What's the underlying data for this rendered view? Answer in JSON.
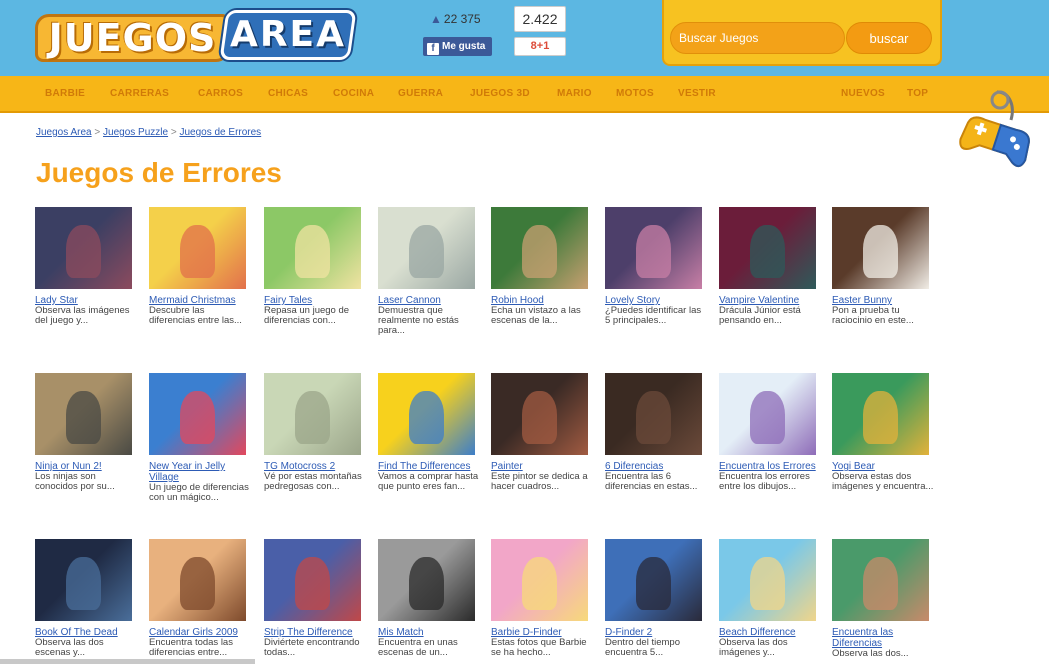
{
  "header": {
    "logo_word1": "JUEGOS",
    "logo_word2": "AREA",
    "like_count": "22 375",
    "fb_label": "Me gusta",
    "plus_count": "2.422",
    "plus_label": "8+1",
    "search_placeholder": "Buscar Juegos",
    "search_button": "buscar"
  },
  "nav": [
    "BARBIE",
    "CARRERAS",
    "CARROS",
    "CHICAS",
    "COCINA",
    "GUERRA",
    "JUEGOS 3D",
    "MARIO",
    "MOTOS",
    "VESTIR",
    "NUEVOS",
    "TOP"
  ],
  "breadcrumb": [
    "Juegos Area",
    "Juegos Puzzle",
    "Juegos de Errores"
  ],
  "breadcrumb_sep": ">",
  "page_title": "Juegos de Errores",
  "games": [
    {
      "title": "Lady Star",
      "desc": "Observa las imágenes del juego y..."
    },
    {
      "title": "Mermaid Christmas",
      "desc": "Descubre las diferencias entre las..."
    },
    {
      "title": "Fairy Tales",
      "desc": "Repasa un juego de diferencias con..."
    },
    {
      "title": "Laser Cannon",
      "desc": "Demuestra que realmente no estás para..."
    },
    {
      "title": "Robin Hood",
      "desc": "Echa un vistazo a las escenas de la..."
    },
    {
      "title": "Lovely Story",
      "desc": "¿Puedes identificar las 5 principales..."
    },
    {
      "title": "Vampire Valentine",
      "desc": "Drácula Júnior está pensando en..."
    },
    {
      "title": "Easter Bunny",
      "desc": "Pon a prueba tu raciocinio en este..."
    },
    {
      "title": "Ninja or Nun 2!",
      "desc": "Los ninjas son conocidos por su..."
    },
    {
      "title": "New Year in Jelly Village",
      "desc": "Un juego de diferencias con un mágico..."
    },
    {
      "title": "TG Motocross 2",
      "desc": "Vé por estas montañas pedregosas con..."
    },
    {
      "title": "Find The Differences",
      "desc": "Vamos a comprar hasta que punto eres fan..."
    },
    {
      "title": "Painter",
      "desc": "Este pintor se dedica a hacer cuadros..."
    },
    {
      "title": "6 Diferencias",
      "desc": "Encuentra las 6 diferencias en estas..."
    },
    {
      "title": "Encuentra los Errores",
      "desc": "Encuentra los errores entre los dibujos..."
    },
    {
      "title": "Yogi Bear",
      "desc": "Observa estas dos imágenes y encuentra..."
    },
    {
      "title": "Book Of The Dead",
      "desc": "Observa las dos escenas y..."
    },
    {
      "title": "Calendar Girls 2009",
      "desc": "Encuentra todas las diferencias entre..."
    },
    {
      "title": "Strip The Difference",
      "desc": "Diviértete encontrando todas..."
    },
    {
      "title": "Mis Match",
      "desc": "Encuentra en unas escenas de un..."
    },
    {
      "title": "Barbie D-Finder",
      "desc": "Estas fotos que Barbie se ha hecho..."
    },
    {
      "title": "D-Finder 2",
      "desc": "Dentro del tiempo encuentra 5..."
    },
    {
      "title": "Beach Difference",
      "desc": "Observa las dos imágenes y..."
    },
    {
      "title": "Encuentra las Diferencias",
      "desc": "Observa las dos..."
    }
  ],
  "thumb_colors": [
    [
      "#3b3f63",
      "#8c4b5e"
    ],
    [
      "#f4d04a",
      "#e2704b"
    ],
    [
      "#8cc866",
      "#f0e3a2"
    ],
    [
      "#d9dfd0",
      "#9aa7a3"
    ],
    [
      "#3d7a3a",
      "#c8a071"
    ],
    [
      "#4d3f6a",
      "#c87fa6"
    ],
    [
      "#6b1d3a",
      "#2e5a5a"
    ],
    [
      "#5a3b2a",
      "#f1ede6"
    ],
    [
      "#a89068",
      "#4a4a44"
    ],
    [
      "#3b7fd0",
      "#e2485d"
    ],
    [
      "#c9d7b6",
      "#9ba58a"
    ],
    [
      "#f7d11d",
      "#3d7ec9"
    ],
    [
      "#3a2a25",
      "#a15b42"
    ],
    [
      "#3a2a22",
      "#6b4a3a"
    ],
    [
      "#e4eef7",
      "#8e6cb8"
    ],
    [
      "#3a9a5c",
      "#e3b23b"
    ],
    [
      "#1f2a44",
      "#4a6e9a"
    ],
    [
      "#e8b17e",
      "#7e4a2c"
    ],
    [
      "#4a5fa8",
      "#c04848"
    ],
    [
      "#9a9a9a",
      "#2a2a2a"
    ],
    [
      "#f2a6c8",
      "#f7d97a"
    ],
    [
      "#3e6fb8",
      "#2a2a3a"
    ],
    [
      "#7ac8e8",
      "#f0d58a"
    ],
    [
      "#4a9a6a",
      "#c88a6a"
    ]
  ]
}
